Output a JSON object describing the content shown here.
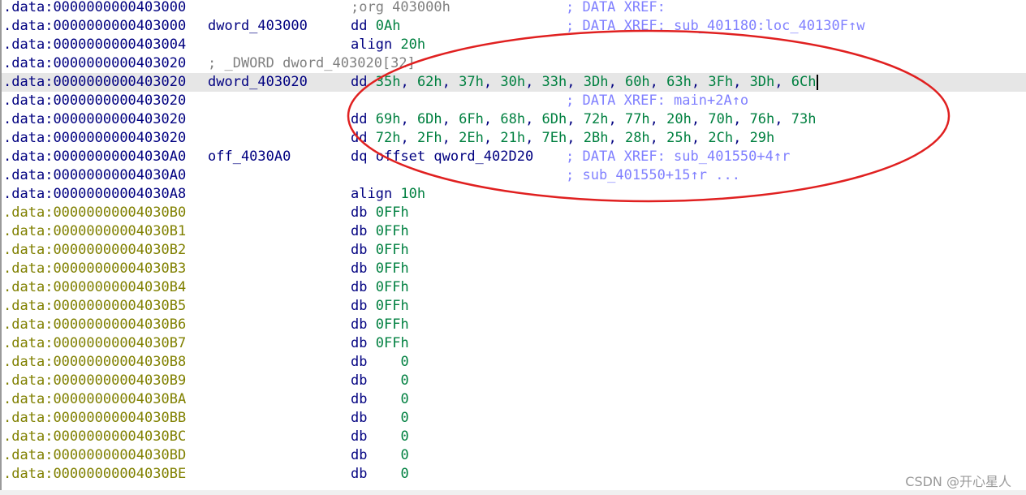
{
  "segment": ".data",
  "rows": [
    {
      "offset": "0000000000403000",
      "olive": false,
      "label": "",
      "mnemonic": ";org 403000h",
      "mn_comment": true,
      "operands": [],
      "xref": "; DATA XREF: ",
      "xref_target": ""
    },
    {
      "offset": "0000000000403000",
      "olive": false,
      "label": "dword_403000",
      "mnemonic": "dd",
      "operands": [
        {
          "t": "0Ah",
          "num": true
        }
      ],
      "xref": "; DATA XREF: sub_401180:loc_40130F↑w"
    },
    {
      "offset": "0000000000403004",
      "olive": false,
      "label": "",
      "mnemonic": "align",
      "operands": [
        {
          "t": "20h",
          "num": true
        }
      ],
      "xref": ""
    },
    {
      "offset": "0000000000403020",
      "olive": false,
      "label": "",
      "comment": "; _DWORD dword_403020[32]",
      "mnemonic": "",
      "operands": [],
      "xref": ""
    },
    {
      "offset": "0000000000403020",
      "olive": false,
      "label": "dword_403020",
      "mnemonic": "dd",
      "highlight": true,
      "cursor": true,
      "operands": [
        {
          "t": "35h",
          "num": true
        },
        {
          "t": "62h",
          "num": true
        },
        {
          "t": "37h",
          "num": true
        },
        {
          "t": "30h",
          "num": true
        },
        {
          "t": "33h",
          "num": true
        },
        {
          "t": "3Dh",
          "num": true
        },
        {
          "t": "60h",
          "num": true
        },
        {
          "t": "63h",
          "num": true
        },
        {
          "t": "3Fh",
          "num": true
        },
        {
          "t": "3Dh",
          "num": true
        },
        {
          "t": "6Ch",
          "num": true
        }
      ],
      "xref": ""
    },
    {
      "offset": "0000000000403020",
      "olive": false,
      "label": "",
      "mnemonic": "",
      "operands": [],
      "xref": "; DATA XREF: main+2A↑o"
    },
    {
      "offset": "0000000000403020",
      "olive": false,
      "label": "",
      "mnemonic": "dd",
      "operands": [
        {
          "t": "69h",
          "num": true
        },
        {
          "t": "6Dh",
          "num": true
        },
        {
          "t": "6Fh",
          "num": true
        },
        {
          "t": "68h",
          "num": true
        },
        {
          "t": "6Dh",
          "num": true
        },
        {
          "t": "72h",
          "num": true
        },
        {
          "t": "77h",
          "num": true
        },
        {
          "t": "20h",
          "num": true
        },
        {
          "t": "70h",
          "num": true
        },
        {
          "t": "76h",
          "num": true
        },
        {
          "t": "73h",
          "num": true
        }
      ],
      "xref": ""
    },
    {
      "offset": "0000000000403020",
      "olive": false,
      "label": "",
      "mnemonic": "dd",
      "operands": [
        {
          "t": "72h",
          "num": true
        },
        {
          "t": "2Fh",
          "num": true
        },
        {
          "t": "2Eh",
          "num": true
        },
        {
          "t": "21h",
          "num": true
        },
        {
          "t": "7Eh",
          "num": true
        },
        {
          "t": "2Bh",
          "num": true
        },
        {
          "t": "28h",
          "num": true
        },
        {
          "t": "25h",
          "num": true
        },
        {
          "t": "2Ch",
          "num": true
        },
        {
          "t": "29h",
          "num": true
        }
      ],
      "xref": ""
    },
    {
      "offset": "00000000004030A0",
      "olive": false,
      "label": "off_4030A0",
      "mnemonic": "dq",
      "operands": [
        {
          "t": "offset qword_402D20",
          "num": false
        }
      ],
      "xref": "; DATA XREF: sub_401550+4↑r"
    },
    {
      "offset": "00000000004030A0",
      "olive": false,
      "label": "",
      "mnemonic": "",
      "operands": [],
      "xref": "; sub_401550+15↑r ..."
    },
    {
      "offset": "00000000004030A8",
      "olive": false,
      "label": "",
      "mnemonic": "align",
      "operands": [
        {
          "t": "10h",
          "num": true
        }
      ],
      "xref": ""
    },
    {
      "offset": "00000000004030B0",
      "olive": true,
      "label": "",
      "mnemonic": "db",
      "operands": [
        {
          "t": "0FFh",
          "num": true
        }
      ],
      "xref": ""
    },
    {
      "offset": "00000000004030B1",
      "olive": true,
      "label": "",
      "mnemonic": "db",
      "operands": [
        {
          "t": "0FFh",
          "num": true
        }
      ],
      "xref": ""
    },
    {
      "offset": "00000000004030B2",
      "olive": true,
      "label": "",
      "mnemonic": "db",
      "operands": [
        {
          "t": "0FFh",
          "num": true
        }
      ],
      "xref": ""
    },
    {
      "offset": "00000000004030B3",
      "olive": true,
      "label": "",
      "mnemonic": "db",
      "operands": [
        {
          "t": "0FFh",
          "num": true
        }
      ],
      "xref": ""
    },
    {
      "offset": "00000000004030B4",
      "olive": true,
      "label": "",
      "mnemonic": "db",
      "operands": [
        {
          "t": "0FFh",
          "num": true
        }
      ],
      "xref": ""
    },
    {
      "offset": "00000000004030B5",
      "olive": true,
      "label": "",
      "mnemonic": "db",
      "operands": [
        {
          "t": "0FFh",
          "num": true
        }
      ],
      "xref": ""
    },
    {
      "offset": "00000000004030B6",
      "olive": true,
      "label": "",
      "mnemonic": "db",
      "operands": [
        {
          "t": "0FFh",
          "num": true
        }
      ],
      "xref": ""
    },
    {
      "offset": "00000000004030B7",
      "olive": true,
      "label": "",
      "mnemonic": "db",
      "operands": [
        {
          "t": "0FFh",
          "num": true
        }
      ],
      "xref": ""
    },
    {
      "offset": "00000000004030B8",
      "olive": true,
      "label": "",
      "mnemonic": "db",
      "operands": [
        {
          "t": "   0",
          "num": true
        }
      ],
      "xref": ""
    },
    {
      "offset": "00000000004030B9",
      "olive": true,
      "label": "",
      "mnemonic": "db",
      "operands": [
        {
          "t": "   0",
          "num": true
        }
      ],
      "xref": ""
    },
    {
      "offset": "00000000004030BA",
      "olive": true,
      "label": "",
      "mnemonic": "db",
      "operands": [
        {
          "t": "   0",
          "num": true
        }
      ],
      "xref": ""
    },
    {
      "offset": "00000000004030BB",
      "olive": true,
      "label": "",
      "mnemonic": "db",
      "operands": [
        {
          "t": "   0",
          "num": true
        }
      ],
      "xref": ""
    },
    {
      "offset": "00000000004030BC",
      "olive": true,
      "label": "",
      "mnemonic": "db",
      "operands": [
        {
          "t": "   0",
          "num": true
        }
      ],
      "xref": ""
    },
    {
      "offset": "00000000004030BD",
      "olive": true,
      "label": "",
      "mnemonic": "db",
      "operands": [
        {
          "t": "   0",
          "num": true
        }
      ],
      "xref": ""
    },
    {
      "offset": "00000000004030BE",
      "olive": true,
      "label": "",
      "mnemonic": "db",
      "operands": [
        {
          "t": "   0",
          "num": true
        }
      ],
      "xref": ""
    }
  ],
  "watermark": "CSDN @开心星人",
  "colors": {
    "annotation_ellipse": "#e02020",
    "highlight_row": "#e6e6e6",
    "number": "#008040",
    "xref": "#8080ff",
    "navy": "#000080",
    "olive": "#808000"
  }
}
